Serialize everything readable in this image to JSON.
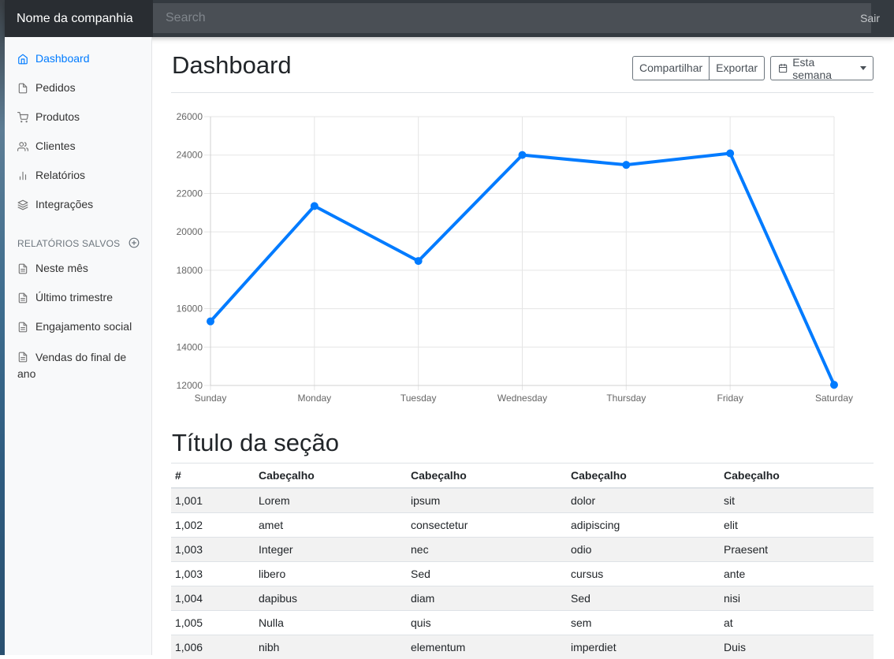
{
  "navbar": {
    "brand": "Nome da companhia",
    "search_placeholder": "Search",
    "signout": "Sair"
  },
  "sidebar": {
    "items": [
      {
        "label": "Dashboard",
        "icon": "home-icon",
        "active": true
      },
      {
        "label": "Pedidos",
        "icon": "file-icon"
      },
      {
        "label": "Produtos",
        "icon": "cart-icon"
      },
      {
        "label": "Clientes",
        "icon": "users-icon"
      },
      {
        "label": "Relatórios",
        "icon": "bar-chart-icon"
      },
      {
        "label": "Integrações",
        "icon": "layers-icon"
      }
    ],
    "saved_heading": "RELATÓRIOS SALVOS",
    "saved_items": [
      {
        "label": "Neste mês",
        "icon": "file-text-icon"
      },
      {
        "label": "Último trimestre",
        "icon": "file-text-icon"
      },
      {
        "label": "Engajamento social",
        "icon": "file-text-icon"
      },
      {
        "label": "Vendas do final de ano",
        "icon": "file-text-icon"
      }
    ]
  },
  "main": {
    "title": "Dashboard",
    "share_label": "Compartilhar",
    "export_label": "Exportar",
    "period_label": "Esta semana",
    "section_title": "Título da seção"
  },
  "colors": {
    "accent": "#007bff",
    "navbar": "#343a40"
  },
  "chart_data": {
    "type": "line",
    "categories": [
      "Sunday",
      "Monday",
      "Tuesday",
      "Wednesday",
      "Thursday",
      "Friday",
      "Saturday"
    ],
    "values": [
      15339,
      21345,
      18483,
      24003,
      23489,
      24092,
      12034
    ],
    "ylim": [
      12000,
      26000
    ],
    "yticks": [
      12000,
      14000,
      16000,
      18000,
      20000,
      22000,
      24000,
      26000
    ],
    "grid": true,
    "color": "#007bff"
  },
  "table": {
    "headers": [
      "#",
      "Cabeçalho",
      "Cabeçalho",
      "Cabeçalho",
      "Cabeçalho"
    ],
    "rows": [
      [
        "1,001",
        "Lorem",
        "ipsum",
        "dolor",
        "sit"
      ],
      [
        "1,002",
        "amet",
        "consectetur",
        "adipiscing",
        "elit"
      ],
      [
        "1,003",
        "Integer",
        "nec",
        "odio",
        "Praesent"
      ],
      [
        "1,003",
        "libero",
        "Sed",
        "cursus",
        "ante"
      ],
      [
        "1,004",
        "dapibus",
        "diam",
        "Sed",
        "nisi"
      ],
      [
        "1,005",
        "Nulla",
        "quis",
        "sem",
        "at"
      ],
      [
        "1,006",
        "nibh",
        "elementum",
        "imperdiet",
        "Duis"
      ]
    ]
  }
}
